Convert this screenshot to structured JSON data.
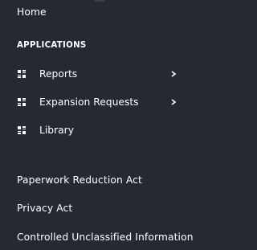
{
  "nav": {
    "home_label": "Home",
    "section_label": "APPLICATIONS",
    "apps": [
      {
        "label": "Reports",
        "icon": "dashboard-icon",
        "has_submenu": true
      },
      {
        "label": "Expansion Requests",
        "icon": "dashboard-icon",
        "has_submenu": true
      },
      {
        "label": "Library",
        "icon": "dashboard-icon",
        "has_submenu": false
      }
    ],
    "footer_links": [
      {
        "label": "Paperwork Reduction Act"
      },
      {
        "label": "Privacy Act"
      },
      {
        "label": "Controlled Unclassified Information"
      }
    ]
  },
  "colors": {
    "background": "#252a32",
    "text": "#ffffff"
  }
}
